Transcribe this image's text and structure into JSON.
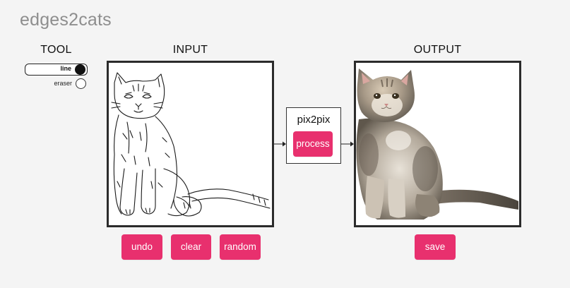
{
  "app": {
    "title": "edges2cats"
  },
  "tool": {
    "heading": "TOOL",
    "options": [
      {
        "label": "line",
        "selected": true
      },
      {
        "label": "eraser",
        "selected": false
      }
    ]
  },
  "input": {
    "heading": "INPUT"
  },
  "processor": {
    "name": "pix2pix",
    "process_label": "process"
  },
  "output": {
    "heading": "OUTPUT",
    "save_label": "save"
  },
  "actions": {
    "undo_label": "undo",
    "clear_label": "clear",
    "random_label": "random"
  },
  "colors": {
    "accent": "#e8306e",
    "title_gray": "#8e8e8e",
    "panel_border": "#2b2b2b",
    "background": "#f4f4f4"
  },
  "icons": {
    "edge_drawing": "cat-edge-sketch",
    "generated_image": "kitten-photo",
    "flow_arrows": "arrow-right-icon"
  }
}
